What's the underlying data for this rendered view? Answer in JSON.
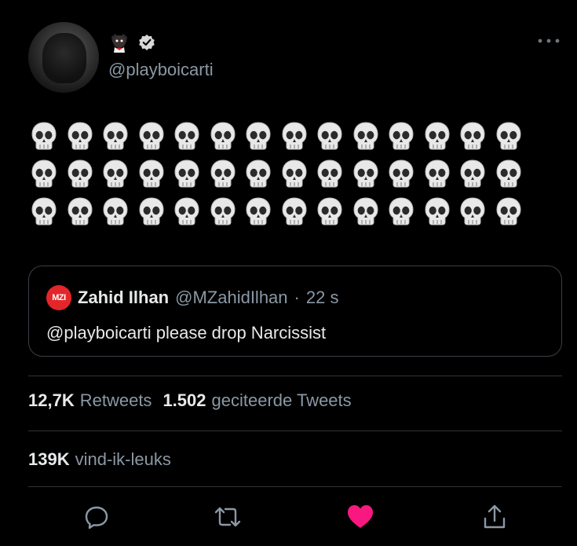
{
  "tweet": {
    "handle": "@playboicarti",
    "name_emoji": "vampire-emoji",
    "verified": true,
    "skull_rows": 3,
    "skulls_per_row": 14,
    "text_emoji": "skull-emoji"
  },
  "quoted_tweet": {
    "avatar_label": "MZI",
    "name": "Zahid Ilhan",
    "handle": "@MZahidIlhan",
    "separator": "·",
    "time": "22 s",
    "text": "@playboicarti please drop Narcissist",
    "avatar_color": "#e3262a"
  },
  "stats": {
    "retweets_count": "12,7K",
    "retweets_label": "Retweets",
    "quotes_count": "1.502",
    "quotes_label": "geciteerde Tweets",
    "likes_count": "139K",
    "likes_label": "vind-ik-leuks"
  },
  "actions": {
    "reply_icon": "reply-icon",
    "retweet_icon": "retweet-icon",
    "like_icon": "heart-icon",
    "like_active": true,
    "like_color": "#f91880",
    "share_icon": "share-icon"
  },
  "colors": {
    "background": "#000000",
    "secondary_text": "#8b98a5",
    "border": "#2f3336"
  }
}
